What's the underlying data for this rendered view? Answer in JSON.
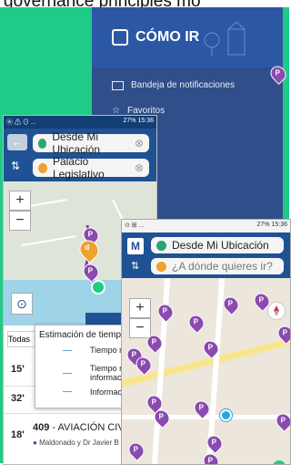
{
  "caption": "governance principles mo",
  "menu": {
    "title": "CÓMO IR",
    "items": [
      {
        "label": "Bandeja de notificaciones",
        "icon": "mail-icon"
      },
      {
        "label": "Favoritos",
        "icon": "star-icon"
      }
    ]
  },
  "screen2": {
    "status": "ⓦ ⚠ ⊙ ...",
    "status_right": "27% 15:36",
    "origin": "Desde Mi Ubicación",
    "destination": "Palacio Legislativo",
    "popup": {
      "title": "Estimación de tiempo",
      "items": [
        "Tiempo re",
        "Tiempo re informació",
        "Informació"
      ]
    },
    "list": {
      "todas": "Todas",
      "rows": [
        {
          "time": "15'",
          "line": "",
          "desc": ""
        },
        {
          "time": "32'",
          "line": "",
          "desc": ""
        },
        {
          "time": "18'",
          "line": "409",
          "name": " - AVIACIÓN CIVIL",
          "desc": "Maldonado y Dr Javier B"
        }
      ]
    },
    "map_pins": [
      "P",
      "d",
      "P"
    ]
  },
  "screen3": {
    "status": "⊙ ⊞ ...",
    "status_right": "27% 15:36",
    "origin": "Desde Mi Ubicación",
    "destination_placeholder": "¿A dónde quieres ir?",
    "pin_label": "P",
    "small_pin_label": "o"
  },
  "colors": {
    "green": "#1fcb87",
    "navy": "#1f5294",
    "pin": "#8a4ab0",
    "origin_dot": "#2aa56f",
    "dest_dot": "#f0a22d"
  }
}
